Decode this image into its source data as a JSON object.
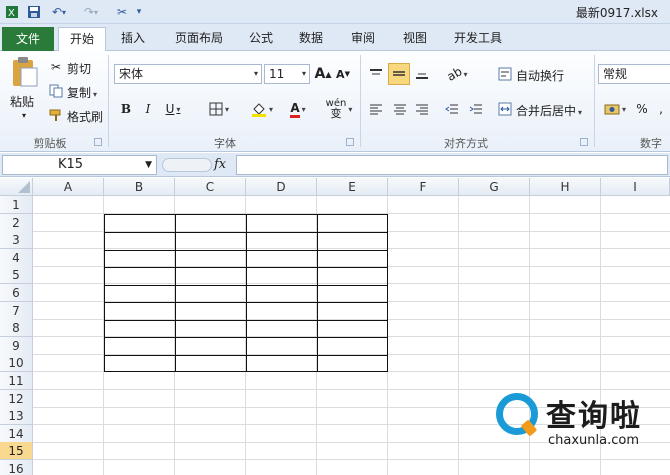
{
  "titlebar": {
    "title": "最新0917.xlsx",
    "quick_access": [
      "save-icon",
      "undo-icon",
      "redo-icon",
      "customize-icon"
    ]
  },
  "tabs": [
    "文件",
    "开始",
    "插入",
    "页面布局",
    "公式",
    "数据",
    "审阅",
    "视图",
    "开发工具"
  ],
  "ribbon": {
    "clipboard": {
      "paste": "粘贴",
      "cut": "剪切",
      "copy": "复制",
      "format_painter": "格式刷",
      "group_label": "剪贴板"
    },
    "font": {
      "font_name": "宋体",
      "font_size": "11",
      "bold": "B",
      "italic": "I",
      "underline": "U",
      "grow": "A",
      "shrink": "A",
      "font_color": "A",
      "wen": "wén",
      "zi": "变",
      "group_label": "字体"
    },
    "alignment": {
      "wrap": "自动换行",
      "merge": "合并后居中",
      "group_label": "对齐方式"
    },
    "number": {
      "format": "常规",
      "percent": "%",
      "group_label": "数字"
    }
  },
  "formula_bar": {
    "name_box": "K15",
    "fx": "fx"
  },
  "grid": {
    "columns": [
      "A",
      "B",
      "C",
      "D",
      "E",
      "F",
      "G",
      "H",
      "I"
    ],
    "rows": [
      "1",
      "2",
      "3",
      "4",
      "5",
      "6",
      "7",
      "8",
      "9",
      "10",
      "11",
      "12",
      "13",
      "14",
      "15",
      "16"
    ],
    "selected_row": "15",
    "table_range": "B2:E10"
  },
  "watermark": {
    "cn": "查询啦",
    "en": "chaxunla.com"
  },
  "colors": {
    "file_tab": "#2a7a3a",
    "accent": "#dfe9f5",
    "selected_row": "#f9d98f",
    "watermark_blue": "#1a9ad6",
    "watermark_orange": "#f29a1a"
  }
}
